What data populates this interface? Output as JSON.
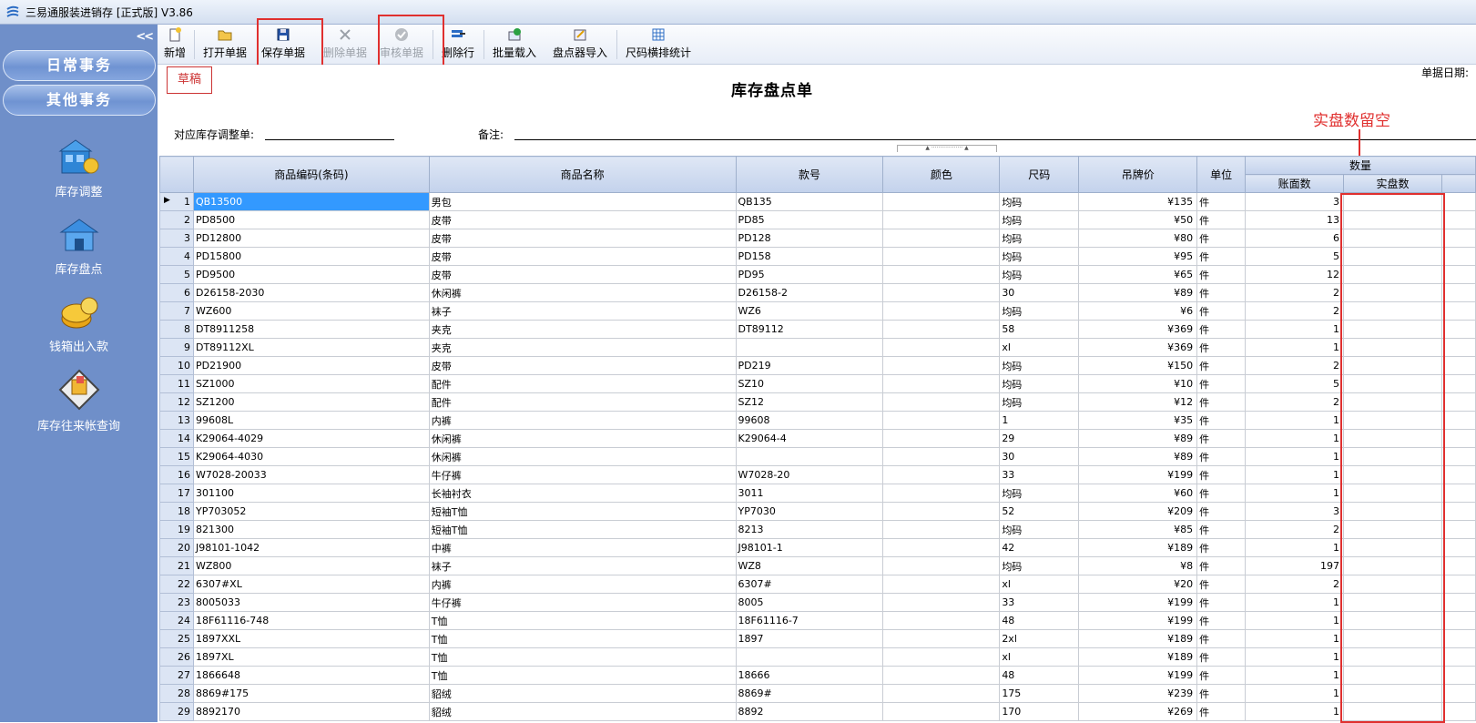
{
  "app": {
    "title": "三易通服装进销存 [正式版] V3.86"
  },
  "sidebar": {
    "collapse_label": "<<",
    "nav_buttons": [
      "日常事务",
      "其他事务"
    ],
    "items": [
      {
        "label": "库存调整",
        "icon": "inventory-adjust-icon"
      },
      {
        "label": "库存盘点",
        "icon": "inventory-count-icon"
      },
      {
        "label": "钱箱出入款",
        "icon": "cash-box-icon"
      },
      {
        "label": "库存往来帐查询",
        "icon": "ledger-query-icon"
      }
    ]
  },
  "toolbar": {
    "new": "新增",
    "open": "打开单据",
    "save": "保存单据",
    "delete_doc": "删除单据",
    "audit": "审核单据",
    "delete_row": "删除行",
    "batch_load": "批量载入",
    "scanner_import": "盘点器导入",
    "size_stats": "尺码横排统计"
  },
  "form": {
    "status": "草稿",
    "title": "库存盘点单",
    "date_label": "单据日期:",
    "adjust_label": "对应库存调整单:",
    "note_label": "备注:",
    "adjust_value": "",
    "note_value": ""
  },
  "annotation": {
    "text": "实盘数留空",
    "color": "#e0302f"
  },
  "grid": {
    "group_header": "数量",
    "columns": [
      "商品编码(条码)",
      "商品名称",
      "款号",
      "颜色",
      "尺码",
      "吊牌价",
      "单位",
      "账面数",
      "实盘数"
    ],
    "rows": [
      [
        "1",
        "QB13500",
        "男包",
        "QB135",
        "",
        "均码",
        "¥135",
        "件",
        "3",
        ""
      ],
      [
        "2",
        "PD8500",
        "皮带",
        "PD85",
        "",
        "均码",
        "¥50",
        "件",
        "13",
        ""
      ],
      [
        "3",
        "PD12800",
        "皮带",
        "PD128",
        "",
        "均码",
        "¥80",
        "件",
        "6",
        ""
      ],
      [
        "4",
        "PD15800",
        "皮带",
        "PD158",
        "",
        "均码",
        "¥95",
        "件",
        "5",
        ""
      ],
      [
        "5",
        "PD9500",
        "皮带",
        "PD95",
        "",
        "均码",
        "¥65",
        "件",
        "12",
        ""
      ],
      [
        "6",
        "D26158-2030",
        "休闲裤",
        "D26158-2",
        "",
        "30",
        "¥89",
        "件",
        "2",
        ""
      ],
      [
        "7",
        "WZ600",
        "袜子",
        "WZ6",
        "",
        "均码",
        "¥6",
        "件",
        "2",
        ""
      ],
      [
        "8",
        "DT8911258",
        "夹克",
        "DT89112",
        "",
        "58",
        "¥369",
        "件",
        "1",
        ""
      ],
      [
        "9",
        "DT89112XL",
        "夹克",
        "",
        "",
        "xl",
        "¥369",
        "件",
        "1",
        ""
      ],
      [
        "10",
        "PD21900",
        "皮带",
        "PD219",
        "",
        "均码",
        "¥150",
        "件",
        "2",
        ""
      ],
      [
        "11",
        "SZ1000",
        "配件",
        "SZ10",
        "",
        "均码",
        "¥10",
        "件",
        "5",
        ""
      ],
      [
        "12",
        "SZ1200",
        "配件",
        "SZ12",
        "",
        "均码",
        "¥12",
        "件",
        "2",
        ""
      ],
      [
        "13",
        "99608L",
        "内裤",
        "99608",
        "",
        "1",
        "¥35",
        "件",
        "1",
        ""
      ],
      [
        "14",
        "K29064-4029",
        "休闲裤",
        "K29064-4",
        "",
        "29",
        "¥89",
        "件",
        "1",
        ""
      ],
      [
        "15",
        "K29064-4030",
        "休闲裤",
        "",
        "",
        "30",
        "¥89",
        "件",
        "1",
        ""
      ],
      [
        "16",
        "W7028-20033",
        "牛仔裤",
        "W7028-20",
        "",
        "33",
        "¥199",
        "件",
        "1",
        ""
      ],
      [
        "17",
        "301100",
        "长袖衬衣",
        "3011",
        "",
        "均码",
        "¥60",
        "件",
        "1",
        ""
      ],
      [
        "18",
        "YP703052",
        "短袖T恤",
        "YP7030",
        "",
        "52",
        "¥209",
        "件",
        "3",
        ""
      ],
      [
        "19",
        "821300",
        "短袖T恤",
        "8213",
        "",
        "均码",
        "¥85",
        "件",
        "2",
        ""
      ],
      [
        "20",
        "J98101-1042",
        "中裤",
        "J98101-1",
        "",
        "42",
        "¥189",
        "件",
        "1",
        ""
      ],
      [
        "21",
        "WZ800",
        "袜子",
        "WZ8",
        "",
        "均码",
        "¥8",
        "件",
        "197",
        ""
      ],
      [
        "22",
        "6307#XL",
        "内裤",
        "6307#",
        "",
        "xl",
        "¥20",
        "件",
        "2",
        ""
      ],
      [
        "23",
        "8005033",
        "牛仔裤",
        "8005",
        "",
        "33",
        "¥199",
        "件",
        "1",
        ""
      ],
      [
        "24",
        "18F61116-748",
        "T恤",
        "18F61116-7",
        "",
        "48",
        "¥199",
        "件",
        "1",
        ""
      ],
      [
        "25",
        "1897XXL",
        "T恤",
        "1897",
        "",
        "2xl",
        "¥189",
        "件",
        "1",
        ""
      ],
      [
        "26",
        "1897XL",
        "T恤",
        "",
        "",
        "xl",
        "¥189",
        "件",
        "1",
        ""
      ],
      [
        "27",
        "1866648",
        "T恤",
        "18666",
        "",
        "48",
        "¥199",
        "件",
        "1",
        ""
      ],
      [
        "28",
        "8869#175",
        "貂绒",
        "8869#",
        "",
        "175",
        "¥239",
        "件",
        "1",
        ""
      ],
      [
        "29",
        "8892170",
        "貂绒",
        "8892",
        "",
        "170",
        "¥269",
        "件",
        "1",
        ""
      ]
    ]
  }
}
